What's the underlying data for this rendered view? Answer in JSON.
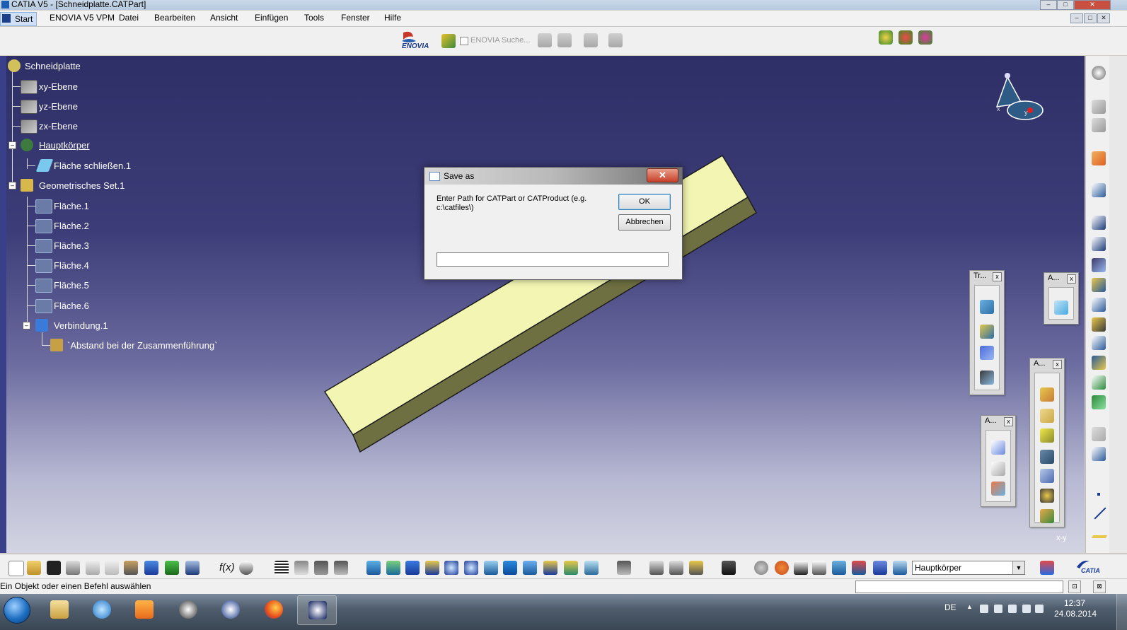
{
  "window": {
    "title": "CATIA V5 - [Schneidplatte.CATPart]",
    "controls": [
      "–",
      "□",
      "✕"
    ]
  },
  "menubar": {
    "items": [
      "Start",
      "ENOVIA V5 VPM",
      "Datei",
      "Bearbeiten",
      "Ansicht",
      "Einfügen",
      "Tools",
      "Fenster",
      "Hilfe"
    ]
  },
  "toptoolbar": {
    "enovia_logo": "ENOVIA",
    "enovia_search": "ENOVIA Suche..."
  },
  "tree": {
    "root": "Schneidplatte",
    "items": [
      {
        "label": "xy-Ebene",
        "icon": "plane-icon"
      },
      {
        "label": "yz-Ebene",
        "icon": "plane-icon"
      },
      {
        "label": "zx-Ebene",
        "icon": "plane-icon"
      },
      {
        "label": "Hauptkörper",
        "icon": "body-icon"
      },
      {
        "label": "Fläche schließen.1",
        "icon": "close-surface-icon"
      },
      {
        "label": "Geometrisches Set.1",
        "icon": "geometrical-set-icon"
      },
      {
        "label": "Fläche.1",
        "icon": "surface-icon"
      },
      {
        "label": "Fläche.2",
        "icon": "surface-icon"
      },
      {
        "label": "Fläche.3",
        "icon": "surface-icon"
      },
      {
        "label": "Fläche.4",
        "icon": "surface-icon"
      },
      {
        "label": "Fläche.5",
        "icon": "surface-icon"
      },
      {
        "label": "Fläche.6",
        "icon": "surface-icon"
      },
      {
        "label": "Verbindung.1",
        "icon": "join-icon"
      },
      {
        "label": "`Abstand bei der Zusammenführung`",
        "icon": "parameter-icon"
      }
    ]
  },
  "compass": {
    "x": "x",
    "y": "y"
  },
  "dialog": {
    "title": "Save as",
    "close": "✕",
    "message": "Enter Path for CATPart or CATProduct (e.g. c:\\catfiles\\)",
    "ok_label": "OK",
    "cancel_label": "Abbrechen",
    "path_value": ""
  },
  "palettes": {
    "transform": {
      "title": "Tr...",
      "close": "x"
    },
    "a1": {
      "title": "A...",
      "close": "x"
    },
    "a2": {
      "title": "A...",
      "close": "x"
    },
    "a3": {
      "title": "A...",
      "close": "x"
    }
  },
  "viewport": {
    "axis_label": "x-y"
  },
  "bottomtoolbar": {
    "fx_label": "f(x)",
    "layer_value": "Hauptkörper",
    "dropdown_arrow": "▼",
    "catia_logo": "CATIA"
  },
  "statusbar": {
    "message": "Ein Objekt oder einen Befehl auswählen",
    "btn1": "⊡",
    "btn2": "⊠"
  },
  "taskbar": {
    "lang": "DE",
    "time": "12:37",
    "date": "24.08.2014",
    "tray_arrow": "▲"
  },
  "colors": {
    "viewport_top": "#2f2f67",
    "viewport_bottom": "#d3d4e2",
    "part_face": "#f3f6b3",
    "part_side": "#6e7042"
  }
}
